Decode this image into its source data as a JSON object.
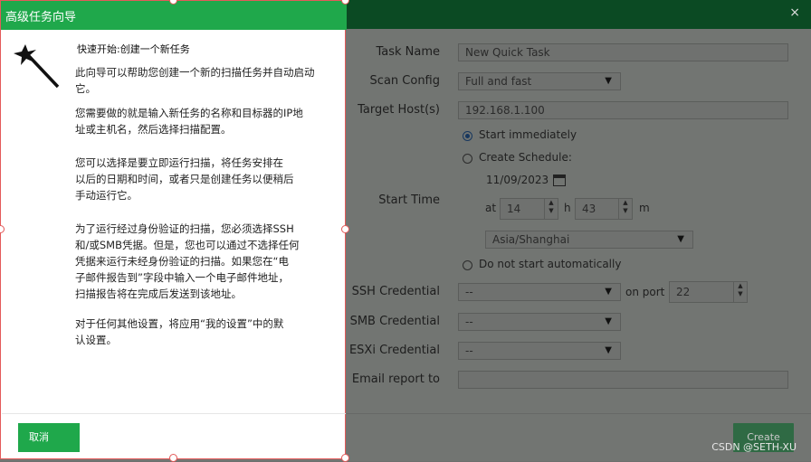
{
  "background_dialog": {
    "close": "×",
    "labels": {
      "task_name": "Task Name",
      "scan_config": "Scan Config",
      "target_hosts": "Target Host(s)",
      "start_time": "Start Time",
      "ssh_credential": "SSH Credential",
      "smb_credential": "SMB Credential",
      "esxi_credential": "ESXi Credential",
      "email_report": "Email report to"
    },
    "task_name_value": "New Quick Task",
    "scan_config_value": "Full and fast",
    "target_hosts_value": "192.168.1.100",
    "start_immediately": "Start immediately",
    "create_schedule": "Create Schedule:",
    "schedule_date": "11/09/2023",
    "at_label": "at",
    "hour_value": "14",
    "h_label": "h",
    "minute_value": "43",
    "m_label": "m",
    "timezone": "Asia/Shanghai",
    "do_not_start": "Do not start automatically",
    "ssh_value": "--",
    "on_port_label": "on port",
    "port_value": "22",
    "smb_value": "--",
    "esxi_value": "--",
    "email_value": "",
    "create_button": "Create"
  },
  "wizard": {
    "title": "高级任务向导",
    "subtitle": "快速开始:创建一个新任务",
    "paragraphs": [
      "此向导可以帮助您创建一个新的扫描任务并自动启动\n它。",
      "您需要做的就是输入新任务的名称和目标器的IP地\n址或主机名，然后选择扫描配置。",
      "您可以选择是要立即运行扫描，将任务安排在\n以后的日期和时间，或者只是创建任务以便稍后\n手动运行它。",
      "为了运行经过身份验证的扫描，您必须选择SSH\n和/或SMB凭据。但是，您也可以通过不选择任何\n凭据来运行未经身份验证的扫描。如果您在“电\n子邮件报告到”字段中输入一个电子邮件地址，\n扫描报告将在完成后发送到该地址。",
      "对于任何其他设置，将应用“我的设置”中的默\n认设置。"
    ],
    "cancel_button": "取消"
  },
  "watermark": "CSDN @SETH-XU",
  "colors": {
    "wizard_accent": "#1fa84b",
    "selection_border": "#e45a5a",
    "overlay": "#727572",
    "bg_header": "#0b4a23"
  }
}
